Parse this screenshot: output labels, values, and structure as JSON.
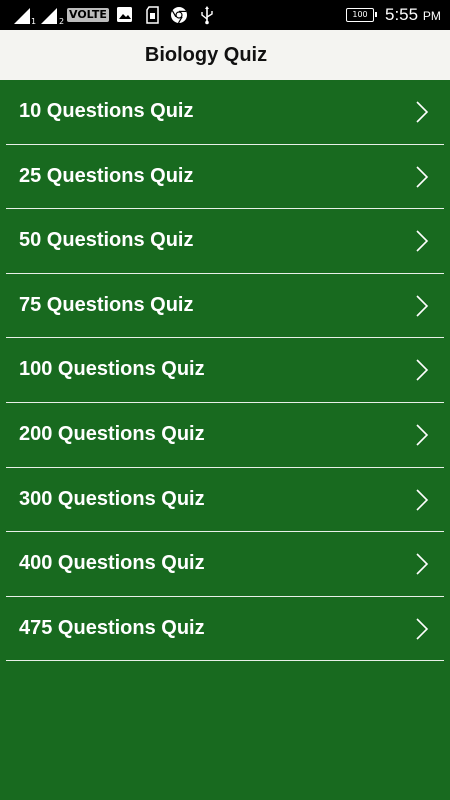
{
  "status_bar": {
    "sim1": "1",
    "sim2": "2",
    "volte": "VOLTE",
    "battery": "100",
    "time": "5:55",
    "ampm": "PM"
  },
  "app_bar": {
    "title": "Biology Quiz"
  },
  "quiz_list": {
    "items": [
      {
        "label": "10 Questions Quiz"
      },
      {
        "label": "25 Questions Quiz"
      },
      {
        "label": "50 Questions Quiz"
      },
      {
        "label": "75 Questions Quiz"
      },
      {
        "label": "100 Questions Quiz"
      },
      {
        "label": "200 Questions Quiz"
      },
      {
        "label": "300 Questions Quiz"
      },
      {
        "label": "400 Questions Quiz"
      },
      {
        "label": "475 Questions Quiz"
      }
    ],
    "chevron_icon": "chevron-right-icon"
  },
  "colors": {
    "background": "#186a1f",
    "app_bar": "#f4f4f1",
    "divider": "#e8f0e8",
    "text_light": "#ffffff",
    "text_dark": "#111111"
  }
}
